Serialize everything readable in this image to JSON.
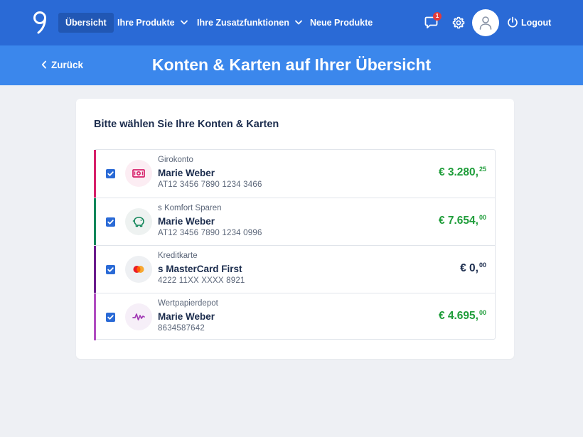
{
  "nav": {
    "items": [
      {
        "label": "Übersicht",
        "active": true
      },
      {
        "label": "Ihre Produkte",
        "dropdown": true
      },
      {
        "label": "Ihre Zusatzfunktionen",
        "dropdown": true
      },
      {
        "label": "Neue Produkte"
      }
    ],
    "messages_badge": "1",
    "logout_label": "Logout",
    "icons": [
      "logo-icon",
      "chat-icon",
      "gear-icon",
      "user-icon",
      "power-icon"
    ]
  },
  "subheader": {
    "back_label": "Zurück",
    "title": "Konten & Karten auf Ihrer Übersicht"
  },
  "card": {
    "title": "Bitte wählen Sie Ihre Konten & Karten"
  },
  "accounts": [
    {
      "type": "Girokonto",
      "name": "Marie Weber",
      "number": "AT12 3456 7890 1234 3466",
      "amount_main": "€ 3.280,",
      "amount_cents": "25",
      "checked": true,
      "color": "#d61f69",
      "icon": "banknote-icon"
    },
    {
      "type": "s Komfort Sparen",
      "name": "Marie Weber",
      "number": "AT12 3456 7890 1234 0996",
      "amount_main": "€ 7.654,",
      "amount_cents": "00",
      "checked": true,
      "color": "#12865a",
      "icon": "piggy-bank-icon"
    },
    {
      "type": "Kreditkarte",
      "name": "s MasterCard First",
      "number": "4222 11XX XXXX 8921",
      "amount_main": "€ 0,",
      "amount_cents": "00",
      "checked": true,
      "color": "#6a1b8c",
      "icon": "mastercard-icon"
    },
    {
      "type": "Wertpapierdepot",
      "name": "Marie Weber",
      "number": "8634587642",
      "amount_main": "€ 4.695,",
      "amount_cents": "00",
      "checked": true,
      "color": "#b04cc0",
      "icon": "chart-line-icon"
    }
  ],
  "colors": {
    "nav_bg": "#2a6ad6",
    "subheader_bg": "#3b87ec",
    "page_bg": "#eef0f4",
    "positive_amount": "#1f9d3a",
    "text_dark": "#1a2b4c"
  }
}
